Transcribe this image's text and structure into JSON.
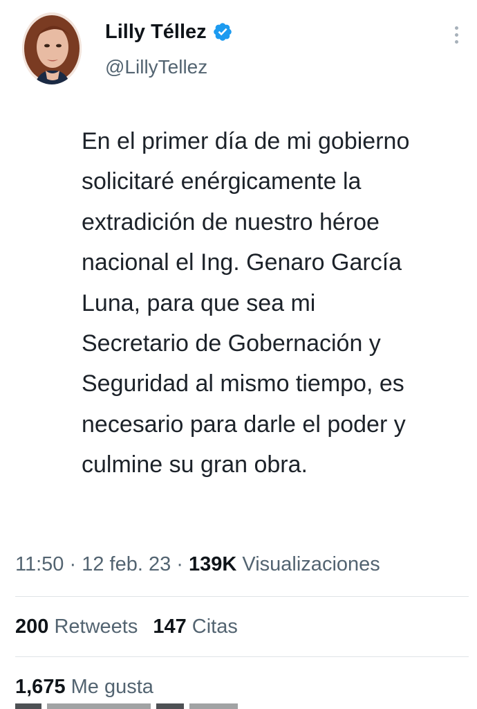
{
  "author": {
    "display_name": "Lilly Téllez",
    "handle": "@LillyTellez",
    "verified": true,
    "verified_icon": "verified-badge-icon",
    "avatar": "profile-photo"
  },
  "menu_icon": "more-vertical-icon",
  "tweet": {
    "lines": [
      "En el primer día de mi gobierno",
      "solicitaré enérgicamente la",
      "extradición de nuestro héroe",
      "nacional el Ing. Genaro García",
      "Luna, para que sea mi",
      "Secretario de Gobernación y",
      "Seguridad al mismo tiempo, es",
      "necesario para darle el poder y",
      "culmine su gran obra."
    ]
  },
  "meta": {
    "time": "11:50",
    "separator": "·",
    "date": "12 feb. 23",
    "views_count": "139K",
    "views_label": "Visualizaciones"
  },
  "stats": {
    "retweets_count": "200",
    "retweets_label": "Retweets",
    "quotes_count": "147",
    "quotes_label": "Citas",
    "likes_count": "1,675",
    "likes_label": "Me gusta"
  },
  "colors": {
    "verified_blue": "#1d9bf0",
    "secondary_text": "#536471",
    "primary_text": "#0f1419",
    "divider": "#dfe3e6"
  }
}
